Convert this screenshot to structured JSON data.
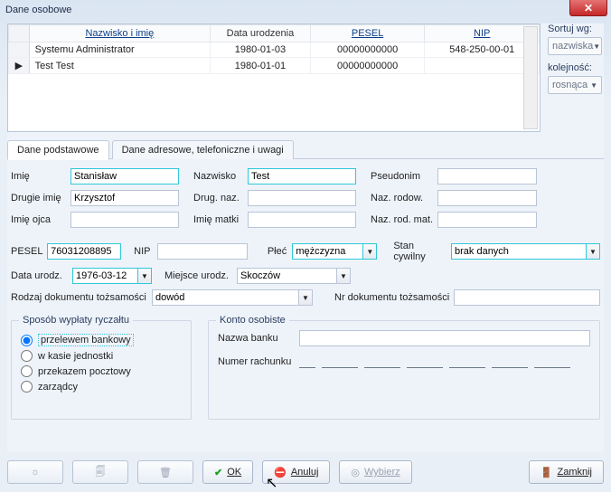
{
  "window": {
    "title": "Dane osobowe"
  },
  "sort": {
    "sort_label": "Sortuj wg:",
    "sort_value": "nazwiska",
    "order_label": "kolejność:",
    "order_value": "rosnąca"
  },
  "grid": {
    "headers": {
      "name": "Nazwisko i imię",
      "dob": "Data urodzenia",
      "pesel": "PESEL",
      "nip": "NIP"
    },
    "rows": [
      {
        "marker": "",
        "name": "Systemu Administrator",
        "dob": "1980-01-03",
        "pesel": "00000000000",
        "nip": "548-250-00-01"
      },
      {
        "marker": "▶",
        "name": "Test Test",
        "dob": "1980-01-01",
        "pesel": "00000000000",
        "nip": ""
      }
    ]
  },
  "tabs": {
    "basic": "Dane podstawowe",
    "address": "Dane adresowe, telefoniczne i uwagi"
  },
  "form": {
    "labels": {
      "imie": "Imię",
      "nazwisko": "Nazwisko",
      "pseudonim": "Pseudonim",
      "drugie_imie": "Drugie imię",
      "drug_naz": "Drug. naz.",
      "naz_rodow": "Naz. rodow.",
      "imie_ojca": "Imię ojca",
      "imie_matki": "Imię matki",
      "naz_rod_mat": "Naz. rod. mat.",
      "pesel": "PESEL",
      "nip": "NIP",
      "plec": "Płeć",
      "stan": "Stan cywilny",
      "data_urodz": "Data urodz.",
      "miejsce_urodz": "Miejsce urodz.",
      "rodzaj_dok": "Rodzaj dokumentu tożsamości",
      "nr_dok": "Nr dokumentu tożsamości"
    },
    "values": {
      "imie": "Stanisław",
      "nazwisko": "Test",
      "pseudonim": "",
      "drugie_imie": "Krzysztof",
      "drug_naz": "",
      "naz_rodow": "",
      "imie_ojca": "",
      "imie_matki": "",
      "naz_rod_mat": "",
      "pesel": "76031208895",
      "nip": "",
      "plec": "mężczyzna",
      "stan": "brak danych",
      "data_urodz": "1976-03-12",
      "miejsce_urodz": "Skoczów",
      "rodzaj_dok": "dowód",
      "nr_dok": ""
    }
  },
  "ryczalt": {
    "legend": "Sposób wypłaty ryczałtu",
    "options": {
      "przelew": "przelewem bankowy",
      "kasa": "w kasie jednostki",
      "poczta": "przekazem pocztowy",
      "zarzadcy": "zarządcy"
    }
  },
  "konto": {
    "legend": "Konto osobiste",
    "bank_label": "Nazwa banku",
    "nr_label": "Numer rachunku",
    "bank_value": "",
    "nr_value": ""
  },
  "buttons": {
    "ok": "OK",
    "anuluj": "Anuluj",
    "wybierz": "Wybierz",
    "zamknij": "Zamknij"
  }
}
